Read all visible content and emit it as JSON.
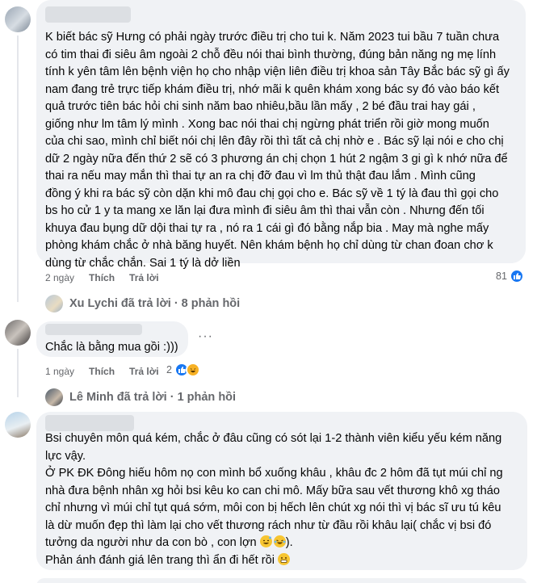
{
  "comment1": {
    "text": "K biết bác sỹ Hưng có phải ngày trước điều trị cho tui k. Năm 2023 tui bầu 7 tuần chưa\ncó tim thai đi siêu âm ngoài 2 chỗ đều nói thai bình thường, đúng bản năng ng mẹ lính\ntính k yên tâm lên bệnh viện họ cho nhập viện liên điều trị khoa sản Tây Bắc bác sỹ gì ấy\nnam đang trẻ trực tiếp khám điều trị, nhớ mãi k quên khám xong bác sy đó vào báo kết\nquả trước tiên bác hỏi chi sinh năm bao nhiêu,bầu lần mấy , 2 bé đầu trai hay gái ,\ngiống như lm tâm lý mình . Xong bac nói thai chị ngừng phát triển rồi giờ mong muốn\ncủa chi sao, mình chỉ biết nói chị lên đây rồi thì tất cả chị nhờ e . Bác sỹ lại nói e cho chị\ndữ 2 ngày nữa đến thứ 2 sẽ có 3 phương án chị chọn 1 hút 2 ngậm 3 gi gì k nhớ nữa để\nthai ra nếu may mắn thì thai tự an ra chị đỡ đau vì lm thủ thật đau lắm . Mình cũng\nđồng ý khi ra bác sỹ còn dặn khi mô đau chị gọi cho e. Bác sỹ về 1 tý là đau thì gọi cho\nbs ho cử 1 y ta mang xe lăn lại đưa mình đi siêu âm thì thai vẫn còn . Nhưng đến tối\nkhuya đau bụng dữ dội thai tự ra , nó ra 1 cái gì đó bằng nắp bia . May mà nghe mấy\nphòng khám chắc ở nhà băng huyết. Nên khám bệnh họ chỉ dùng từ chan đoan chơ k\ndùng từ chắc chắn. Sai 1 tý là dở liền",
    "time": "2 ngày",
    "like": "Thích",
    "reply": "Trả lời",
    "reaction_count": "81",
    "replies_label": "Xu Lychi đã trả lời · 8 phản hồi"
  },
  "comment2": {
    "text": "Chắc là bằng mua gồi :)))",
    "time": "1 ngày",
    "like": "Thích",
    "reply": "Trả lời",
    "reaction_count": "2",
    "more": "···",
    "replies_label": "Lê Minh đã trả lời · 1 phản hồi"
  },
  "comment3": {
    "text": "Bsi chuyên môn quá kém, chắc ở đâu cũng có sót lại 1-2 thành viên kiểu yếu kém năng\nlực vậy.\nỞ PK ĐK Đông hiếu hôm nọ con mình bổ xuống khâu , khâu đc 2 hôm đã tụt múi chỉ ng\nnhà đưa bệnh nhân xg hỏi bsi kêu ko can chi mô. Mấy bữa sau vết thương khô xg tháo\nchỉ nhưng vì múi chỉ tụt quá sớm, môi con bị hếch lên chút xg nói thì vị bác sĩ ưu tú kêu\nlà dừ muốn đẹp thì làm lại cho vết thương rách như từ đầu rồi khâu lại( chắc vị bsi đó\ntưởng da người như da con bò , con lợn",
    "text_end": ").",
    "text_last": "Phản ánh đánh giá lên trang thì ẩn đi hết rồi"
  },
  "colors": {
    "bubble": "#f0f2f5",
    "like_blue": "#1877f2",
    "haha_yellow": "#f7b125",
    "muted": "#65676b"
  },
  "icons": [
    "like-icon",
    "haha-icon",
    "grin-sweat-emoji",
    "laugh-cry-emoji",
    "grimace-emoji"
  ]
}
